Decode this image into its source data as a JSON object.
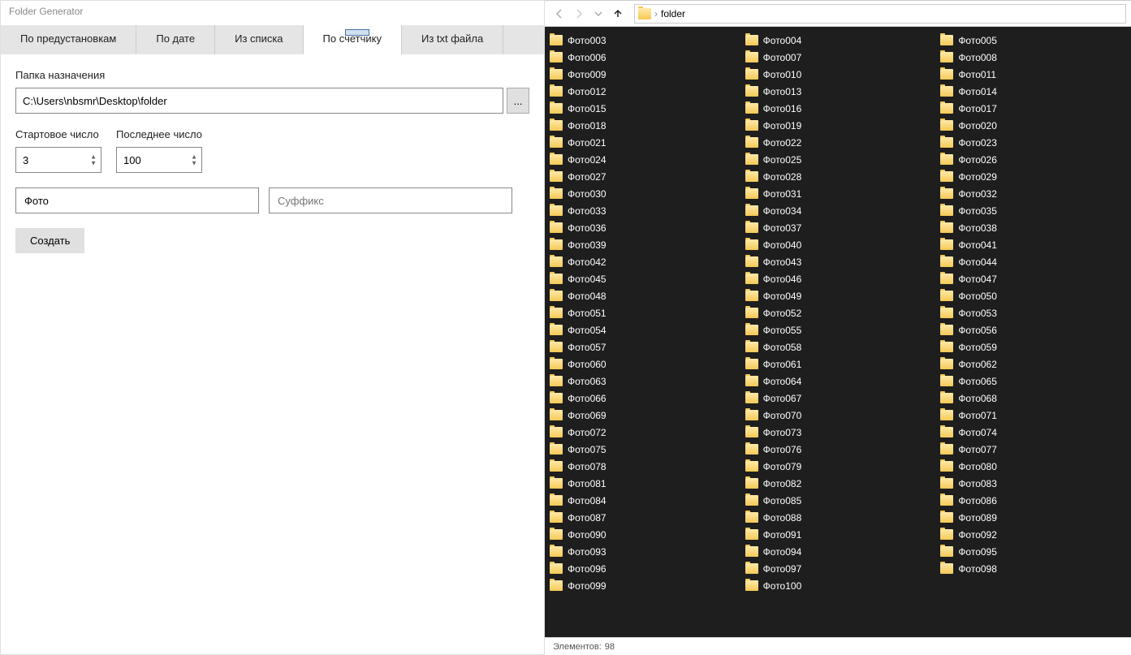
{
  "app": {
    "title": "Folder Generator"
  },
  "tabs": [
    {
      "label": "По предустановкам",
      "active": false
    },
    {
      "label": "По дате",
      "active": false
    },
    {
      "label": "Из списка",
      "active": false
    },
    {
      "label": "По счетчику",
      "active": true
    },
    {
      "label": "Из txt файла",
      "active": false
    }
  ],
  "form": {
    "dest_label": "Папка назначения",
    "dest_path": "C:\\Users\\nbsmr\\Desktop\\folder",
    "browse_label": "...",
    "start_label": "Стартовое число",
    "start_value": "3",
    "end_label": "Последнее число",
    "end_value": "100",
    "prefix_value": "Фото",
    "suffix_placeholder": "Суффикс",
    "create_label": "Создать"
  },
  "explorer": {
    "breadcrumb_sep": "›",
    "breadcrumb_name": "folder",
    "status_label": "Элементов:",
    "status_count": "98",
    "folders": [
      "Фото003",
      "Фото004",
      "Фото005",
      "Фото006",
      "Фото007",
      "Фото008",
      "Фото009",
      "Фото010",
      "Фото011",
      "Фото012",
      "Фото013",
      "Фото014",
      "Фото015",
      "Фото016",
      "Фото017",
      "Фото018",
      "Фото019",
      "Фото020",
      "Фото021",
      "Фото022",
      "Фото023",
      "Фото024",
      "Фото025",
      "Фото026",
      "Фото027",
      "Фото028",
      "Фото029",
      "Фото030",
      "Фото031",
      "Фото032",
      "Фото033",
      "Фото034",
      "Фото035",
      "Фото036",
      "Фото037",
      "Фото038",
      "Фото039",
      "Фото040",
      "Фото041",
      "Фото042",
      "Фото043",
      "Фото044",
      "Фото045",
      "Фото046",
      "Фото047",
      "Фото048",
      "Фото049",
      "Фото050",
      "Фото051",
      "Фото052",
      "Фото053",
      "Фото054",
      "Фото055",
      "Фото056",
      "Фото057",
      "Фото058",
      "Фото059",
      "Фото060",
      "Фото061",
      "Фото062",
      "Фото063",
      "Фото064",
      "Фото065",
      "Фото066",
      "Фото067",
      "Фото068",
      "Фото069",
      "Фото070",
      "Фото071",
      "Фото072",
      "Фото073",
      "Фото074",
      "Фото075",
      "Фото076",
      "Фото077",
      "Фото078",
      "Фото079",
      "Фото080",
      "Фото081",
      "Фото082",
      "Фото083",
      "Фото084",
      "Фото085",
      "Фото086",
      "Фото087",
      "Фото088",
      "Фото089",
      "Фото090",
      "Фото091",
      "Фото092",
      "Фото093",
      "Фото094",
      "Фото095",
      "Фото096",
      "Фото097",
      "Фото098",
      "Фото099",
      "Фото100"
    ]
  }
}
